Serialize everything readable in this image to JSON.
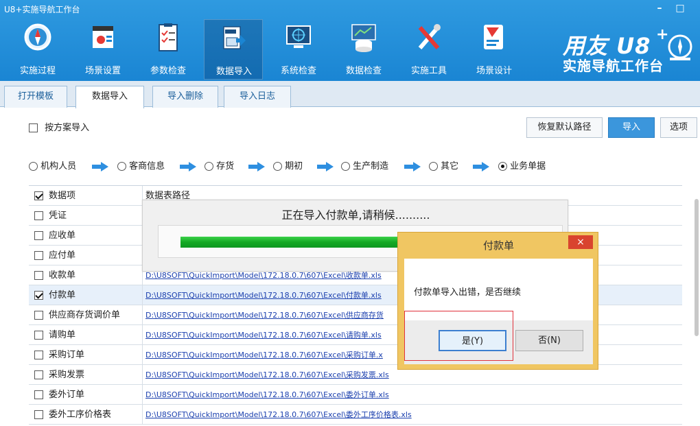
{
  "window": {
    "title": "U8+实施导航工作台",
    "minimize": "–",
    "maximize": "□"
  },
  "toolbar": {
    "items": [
      {
        "label": "实施过程",
        "icon": "compass-icon"
      },
      {
        "label": "场景设置",
        "icon": "scene-settings-icon"
      },
      {
        "label": "参数检查",
        "icon": "checklist-icon"
      },
      {
        "label": "数据导入",
        "icon": "file-import-icon",
        "active": true
      },
      {
        "label": "系统检查",
        "icon": "system-check-icon"
      },
      {
        "label": "数据检查",
        "icon": "database-check-icon"
      },
      {
        "label": "实施工具",
        "icon": "tools-icon"
      },
      {
        "label": "场景设计",
        "icon": "scene-design-icon"
      }
    ]
  },
  "brand": {
    "main": "用友 U8",
    "sup": "+",
    "sub": "实施导航工作台"
  },
  "tabs": [
    {
      "label": "打开模板"
    },
    {
      "label": "数据导入",
      "active": true
    },
    {
      "label": "导入删除"
    },
    {
      "label": "导入日志"
    }
  ],
  "options": {
    "scheme_import_label": "按方案导入",
    "restore_path_label": "恢复默认路径",
    "import_label": "导入",
    "options_label": "选项"
  },
  "steps": [
    {
      "label": "机构人员",
      "selected": false
    },
    {
      "label": "客商信息",
      "selected": false
    },
    {
      "label": "存货",
      "selected": false
    },
    {
      "label": "期初",
      "selected": false
    },
    {
      "label": "生产制造",
      "selected": false
    },
    {
      "label": "其它",
      "selected": false
    },
    {
      "label": "业务单据",
      "selected": true
    }
  ],
  "table": {
    "col_item": "数据项",
    "col_path": "数据表路径",
    "rows": [
      {
        "name": "凭证",
        "checked": false,
        "path": ""
      },
      {
        "name": "应收单",
        "checked": false,
        "path": ""
      },
      {
        "name": "应付单",
        "checked": false,
        "path": ""
      },
      {
        "name": "收款单",
        "checked": false,
        "path": "D:\\U8SOFT\\QuickImport\\Model\\172.18.0.7\\607\\Excel\\收款单.xls"
      },
      {
        "name": "付款单",
        "checked": true,
        "path": "D:\\U8SOFT\\QuickImport\\Model\\172.18.0.7\\607\\Excel\\付款单.xls"
      },
      {
        "name": "供应商存货调价单",
        "checked": false,
        "path": "D:\\U8SOFT\\QuickImport\\Model\\172.18.0.7\\607\\Excel\\供应商存货"
      },
      {
        "name": "请购单",
        "checked": false,
        "path": "D:\\U8SOFT\\QuickImport\\Model\\172.18.0.7\\607\\Excel\\请购单.xls"
      },
      {
        "name": "采购订单",
        "checked": false,
        "path": "D:\\U8SOFT\\QuickImport\\Model\\172.18.0.7\\607\\Excel\\采购订单.x"
      },
      {
        "name": "采购发票",
        "checked": false,
        "path": "D:\\U8SOFT\\QuickImport\\Model\\172.18.0.7\\607\\Excel\\采购发票.xls"
      },
      {
        "name": "委外订单",
        "checked": false,
        "path": "D:\\U8SOFT\\QuickImport\\Model\\172.18.0.7\\607\\Excel\\委外订单.xls"
      },
      {
        "name": "委外工序价格表",
        "checked": false,
        "path": "D:\\U8SOFT\\QuickImport\\Model\\172.18.0.7\\607\\Excel\\委外工序价格表.xls"
      }
    ]
  },
  "progress": {
    "text": "正在导入付款单,请稍候..........",
    "fraction": 0.62
  },
  "dialog": {
    "title": "付款单",
    "close": "×",
    "message": "付款单导入出错，是否继续",
    "yes_label": "是(Y)",
    "no_label": "否(N)"
  },
  "colors": {
    "toolbar_blue": "#1a85d3",
    "progress_green": "#15a925",
    "dialog_frame": "#f0c662",
    "highlight_red": "#e0303a"
  }
}
